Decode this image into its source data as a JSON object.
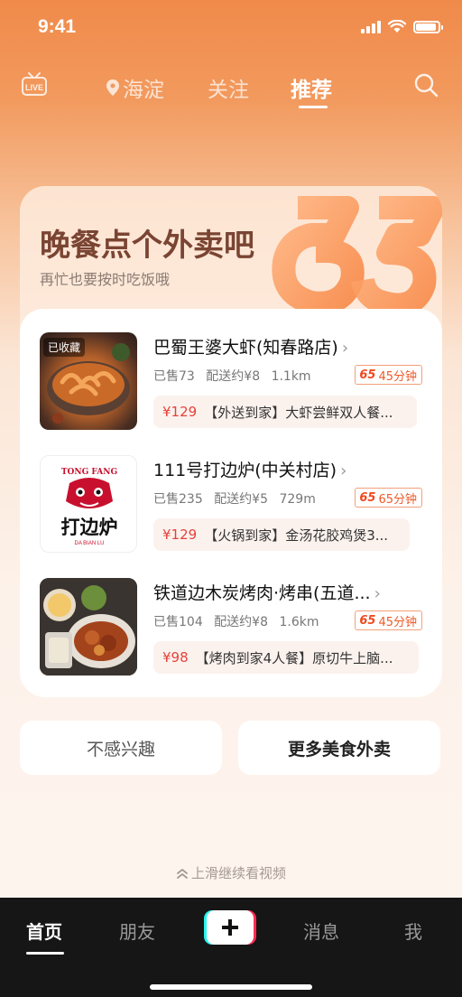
{
  "status_bar": {
    "time": "9:41",
    "battery_level": 0.9
  },
  "top_nav": {
    "live_label": "LIVE",
    "location": "海淀",
    "follow": "关注",
    "recommend": "推荐"
  },
  "card": {
    "title": "晚餐点个外卖吧",
    "subtitle": "再忙也要按时吃饭哦",
    "restaurants": [
      {
        "name": "巴蜀王婆大虾(知春路店)",
        "saved_tag": "已收藏",
        "sold": "已售73",
        "delivery_fee": "配送约¥8",
        "distance": "1.1km",
        "eta": "45分钟",
        "deal_price": "¥129",
        "deal_text": "【外送到家】大虾尝鲜双人餐..."
      },
      {
        "name": "111号打边炉(中关村店)",
        "logo_top_text": "TONG FANG",
        "logo_main_text": "打边炉",
        "logo_bottom_text": "DA BIAN LU",
        "sold": "已售235",
        "delivery_fee": "配送约¥5",
        "distance": "729m",
        "eta": "65分钟",
        "deal_price": "¥129",
        "deal_text": "【火锅到家】金汤花胶鸡煲3..."
      },
      {
        "name": "铁道边木炭烤肉·烤串(五道...",
        "sold": "已售104",
        "delivery_fee": "配送约¥8",
        "distance": "1.6km",
        "eta": "45分钟",
        "deal_price": "¥98",
        "deal_text": "【烤肉到家4人餐】原切牛上脑..."
      }
    ]
  },
  "actions": {
    "not_interested": "不感兴趣",
    "more_food": "更多美食外卖"
  },
  "swipe_hint": "上滑继续看视频",
  "tab_bar": {
    "home": "首页",
    "friends": "朋友",
    "messages": "消息",
    "me": "我"
  },
  "colors": {
    "accent_orange": "#f04a1f",
    "price_red": "#e6423a",
    "title_brown": "#7a4433",
    "tabbar_bg": "#161616"
  },
  "icons": [
    "live-icon",
    "location-pin-icon",
    "search-icon",
    "chevron-right-icon",
    "double-chevron-up-icon",
    "plus-icon"
  ]
}
